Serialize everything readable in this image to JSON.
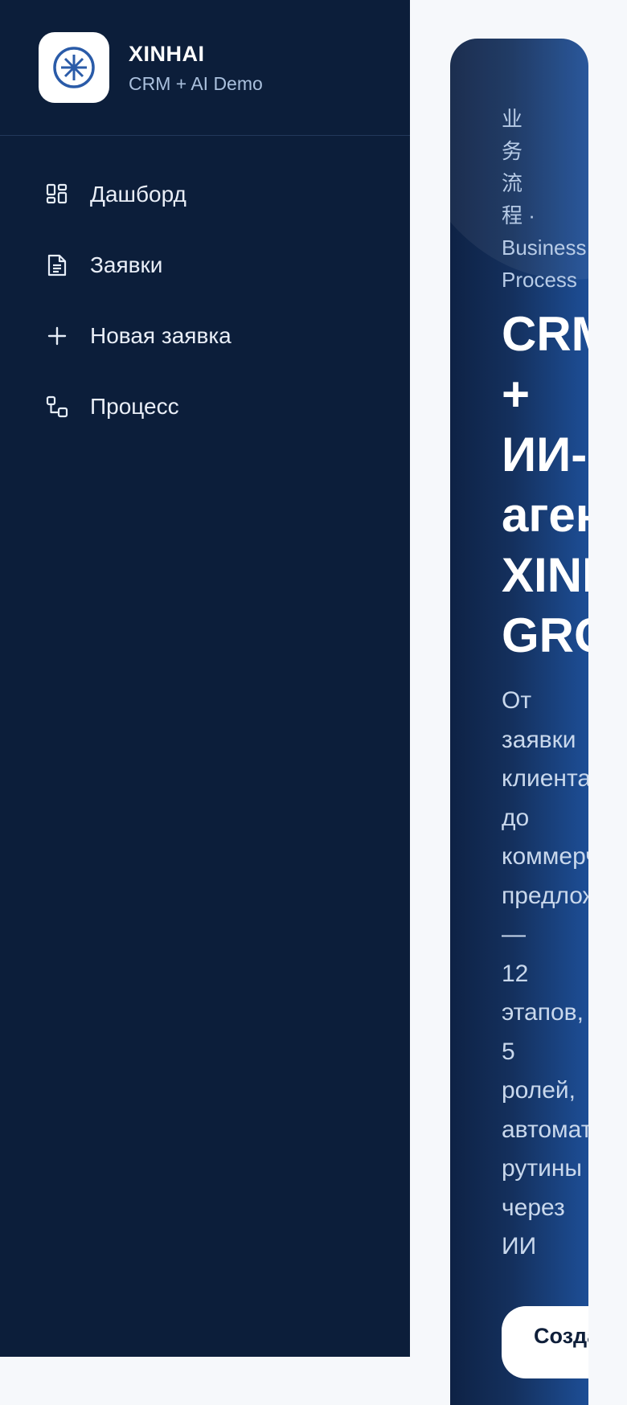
{
  "brand": {
    "title": "XINHAI",
    "subtitle": "CRM + AI Demo",
    "logo_icon": "asterisk-circle-icon"
  },
  "nav": {
    "items": [
      {
        "label": "Дашборд",
        "icon": "dashboard-grid-icon"
      },
      {
        "label": "Заявки",
        "icon": "document-icon"
      },
      {
        "label": "Новая заявка",
        "icon": "plus-icon"
      },
      {
        "label": "Процесс",
        "icon": "workflow-icon"
      }
    ]
  },
  "hero": {
    "eyebrow_cn": [
      "业",
      "务",
      "流",
      "程 ·"
    ],
    "eyebrow_latin": [
      "Business",
      "Process"
    ],
    "title_lines": [
      "CRM",
      "+",
      "ИИ-",
      "агент",
      "XINHAI",
      "GROUP"
    ],
    "description_lines": [
      "От",
      "заявки",
      "клиента",
      "до",
      "коммерческого",
      "предложения",
      "—",
      "12",
      "этапов,",
      "5",
      "ролей,",
      "автоматизация",
      "рутины",
      "через",
      "ИИ"
    ],
    "cta_label": "Создать заявку"
  },
  "colors": {
    "sidebar_bg": "#0c1e3a",
    "hero_gradient_start": "#0e2245",
    "hero_gradient_end": "#1d4e96",
    "logo_accent": "#2a5ba8"
  }
}
